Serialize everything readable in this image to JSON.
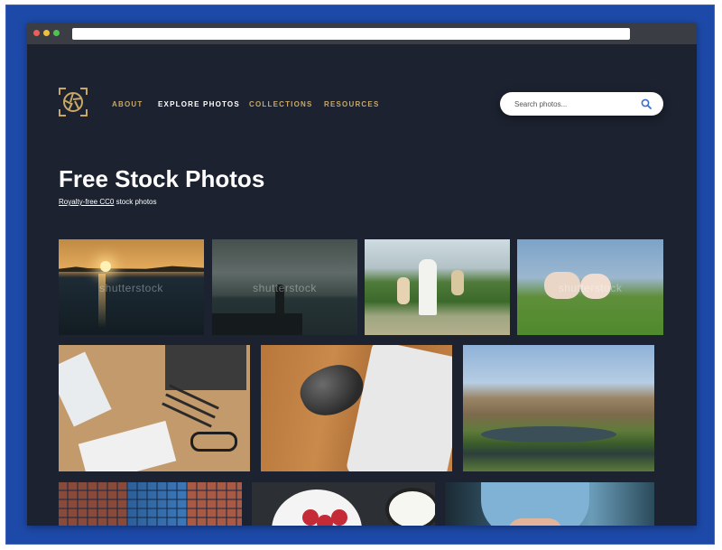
{
  "nav": {
    "items": [
      {
        "label": "ABOUT"
      },
      {
        "label": "EXPLORE PHOTOS"
      },
      {
        "label": "COLLECTIONS"
      },
      {
        "label": "RESOURCES"
      }
    ]
  },
  "search": {
    "placeholder": "Search photos..."
  },
  "hero": {
    "title": "Free Stock Photos",
    "subtitle_link": "Royalty-free CC0",
    "subtitle_rest": " stock photos"
  },
  "photos": {
    "watermark": "shutterstock"
  },
  "colors": {
    "page_bg": "#1c2230",
    "nav_accent": "#c9a865",
    "frame_blue": "#1d49a8",
    "search_icon": "#3b6ccf"
  },
  "icons": {
    "logo": "aperture-logo-icon",
    "search": "search-icon"
  }
}
